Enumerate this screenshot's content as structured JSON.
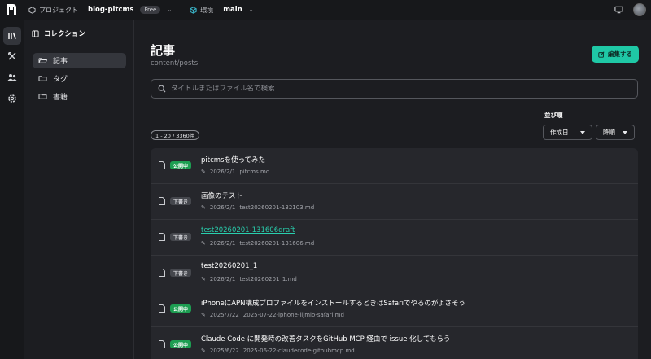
{
  "topbar": {
    "project_label": "プロジェクト",
    "project_name": "blog-pitcms",
    "plan_badge": "Free",
    "env_label": "環境",
    "env_name": "main"
  },
  "sidebar": {
    "title": "コレクション",
    "items": [
      {
        "label": "記事",
        "active": true
      },
      {
        "label": "タグ",
        "active": false
      },
      {
        "label": "書籍",
        "active": false
      }
    ]
  },
  "main": {
    "title": "記事",
    "path": "content/posts",
    "edit_button": "編集する",
    "search_placeholder": "タイトルまたはファイル名で検索",
    "sort_label": "並び順",
    "sort_field": "作成日",
    "sort_order": "降順",
    "count": "1 - 20 / 3360件"
  },
  "posts": [
    {
      "status": "公開中",
      "status_type": "published",
      "title": "pitcmsを使ってみた",
      "date": "2026/2/1",
      "file": "pitcms.md"
    },
    {
      "status": "下書き",
      "status_type": "draft",
      "title": "画像のテスト",
      "date": "2026/2/1",
      "file": "test20260201-132103.md"
    },
    {
      "status": "下書き",
      "status_type": "draft",
      "title": "test20260201-131606draft",
      "date": "2026/2/1",
      "file": "test20260201-131606.md",
      "link": true
    },
    {
      "status": "下書き",
      "status_type": "draft",
      "title": "test20260201_1",
      "date": "2026/2/1",
      "file": "test20260201_1.md"
    },
    {
      "status": "公開中",
      "status_type": "published",
      "title": "iPhoneにAPN構成プロファイルをインストールするときはSafariでやるのがよさそう",
      "date": "2025/7/22",
      "file": "2025-07-22-iphone-iijmio-safari.md"
    },
    {
      "status": "公開中",
      "status_type": "published",
      "title": "Claude Code に開発時の改善タスクをGitHub MCP 経由で issue 化してもらう",
      "date": "2025/6/22",
      "file": "2025-06-22-claudecode-githubmcp.md"
    }
  ],
  "colors": {
    "accent": "#1fc8a6",
    "published": "#1d9e52",
    "draft": "#45474d",
    "link": "#29cfae"
  }
}
